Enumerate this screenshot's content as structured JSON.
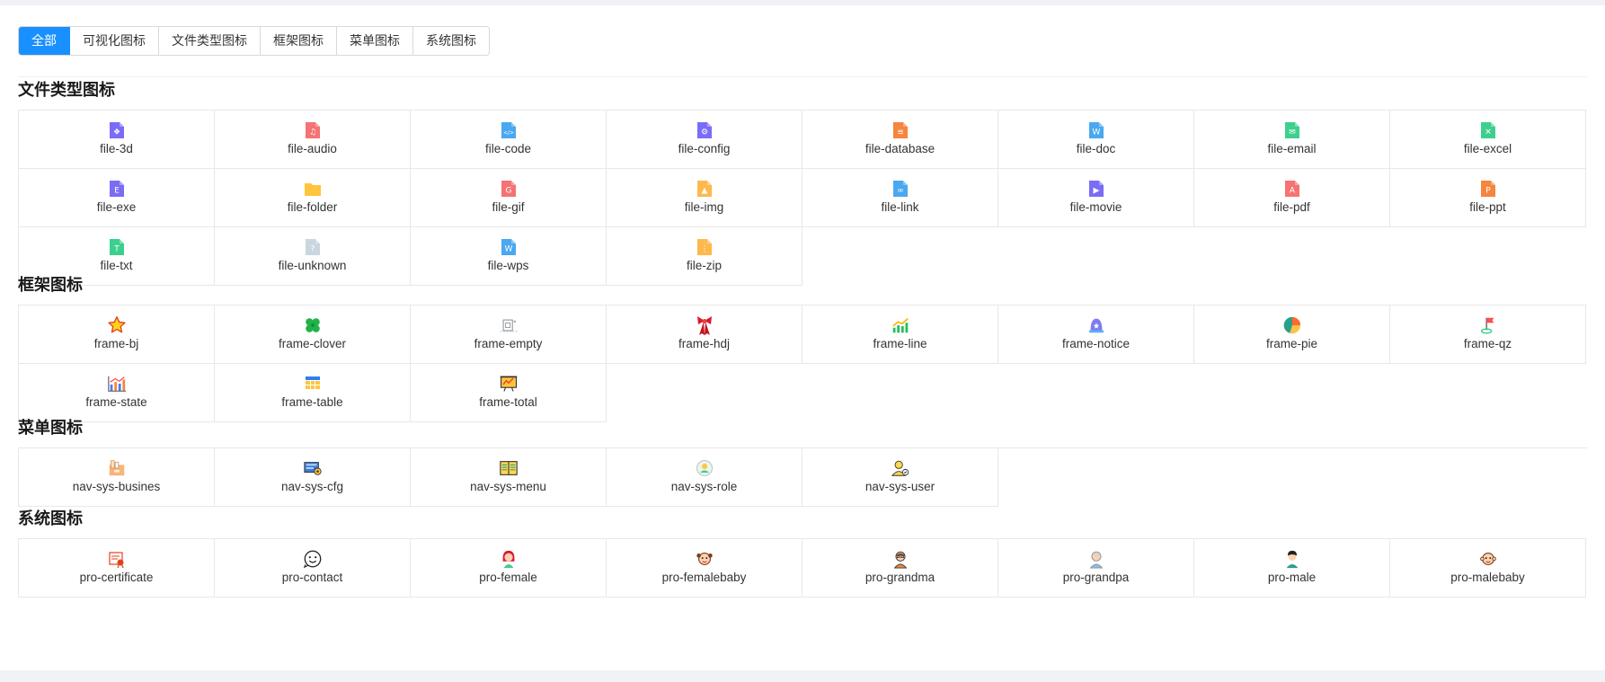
{
  "tabs": [
    {
      "label": "全部",
      "active": true
    },
    {
      "label": "可视化图标",
      "active": false
    },
    {
      "label": "文件类型图标",
      "active": false
    },
    {
      "label": "框架图标",
      "active": false
    },
    {
      "label": "菜单图标",
      "active": false
    },
    {
      "label": "系统图标",
      "active": false
    }
  ],
  "sections": [
    {
      "key": "file",
      "title": "文件类型图标",
      "items": [
        {
          "name": "file-3d",
          "color": "#7b6cf6",
          "glyph": "❖"
        },
        {
          "name": "file-audio",
          "color": "#f57373",
          "glyph": "♫"
        },
        {
          "name": "file-code",
          "color": "#4aa8f0",
          "glyph": "</>"
        },
        {
          "name": "file-config",
          "color": "#7b6cf6",
          "glyph": "⚙"
        },
        {
          "name": "file-database",
          "color": "#f5853f",
          "glyph": "≡"
        },
        {
          "name": "file-doc",
          "color": "#4aa8f0",
          "glyph": "W"
        },
        {
          "name": "file-email",
          "color": "#3ecf8e",
          "glyph": "✉"
        },
        {
          "name": "file-excel",
          "color": "#3ecf8e",
          "glyph": "✕"
        },
        {
          "name": "file-exe",
          "color": "#7b6cf6",
          "glyph": "E"
        },
        {
          "name": "file-folder",
          "color": "#ffc53d",
          "glyph": ""
        },
        {
          "name": "file-gif",
          "color": "#f57373",
          "glyph": "G"
        },
        {
          "name": "file-img",
          "color": "#ffb84d",
          "glyph": "▲"
        },
        {
          "name": "file-link",
          "color": "#4aa8f0",
          "glyph": "∞"
        },
        {
          "name": "file-movie",
          "color": "#7b6cf6",
          "glyph": "▶"
        },
        {
          "name": "file-pdf",
          "color": "#f57373",
          "glyph": "A"
        },
        {
          "name": "file-ppt",
          "color": "#f5853f",
          "glyph": "P"
        },
        {
          "name": "file-txt",
          "color": "#3ecf8e",
          "glyph": "T"
        },
        {
          "name": "file-unknown",
          "color": "#c9d6df",
          "glyph": "?"
        },
        {
          "name": "file-wps",
          "color": "#4aa8f0",
          "glyph": "W"
        },
        {
          "name": "file-zip",
          "color": "#ffb84d",
          "glyph": "⋮"
        }
      ]
    },
    {
      "key": "frame",
      "title": "框架图标",
      "items": [
        {
          "name": "frame-bj",
          "icon": "star"
        },
        {
          "name": "frame-clover",
          "icon": "clover"
        },
        {
          "name": "frame-empty",
          "icon": "empty"
        },
        {
          "name": "frame-hdj",
          "icon": "ribbon"
        },
        {
          "name": "frame-line",
          "icon": "line"
        },
        {
          "name": "frame-notice",
          "icon": "bell"
        },
        {
          "name": "frame-pie",
          "icon": "pie"
        },
        {
          "name": "frame-qz",
          "icon": "flag"
        },
        {
          "name": "frame-state",
          "icon": "state"
        },
        {
          "name": "frame-table",
          "icon": "table"
        },
        {
          "name": "frame-total",
          "icon": "total"
        }
      ]
    },
    {
      "key": "nav",
      "title": "菜单图标",
      "items": [
        {
          "name": "nav-sys-busines",
          "icon": "busines"
        },
        {
          "name": "nav-sys-cfg",
          "icon": "cfg"
        },
        {
          "name": "nav-sys-menu",
          "icon": "menu"
        },
        {
          "name": "nav-sys-role",
          "icon": "role"
        },
        {
          "name": "nav-sys-user",
          "icon": "user"
        }
      ]
    },
    {
      "key": "pro",
      "title": "系统图标",
      "items": [
        {
          "name": "pro-certificate",
          "icon": "certificate"
        },
        {
          "name": "pro-contact",
          "icon": "contact"
        },
        {
          "name": "pro-female",
          "icon": "female"
        },
        {
          "name": "pro-femalebaby",
          "icon": "femalebaby"
        },
        {
          "name": "pro-grandma",
          "icon": "grandma"
        },
        {
          "name": "pro-grandpa",
          "icon": "grandpa"
        },
        {
          "name": "pro-male",
          "icon": "male"
        },
        {
          "name": "pro-malebaby",
          "icon": "malebaby"
        }
      ]
    }
  ]
}
